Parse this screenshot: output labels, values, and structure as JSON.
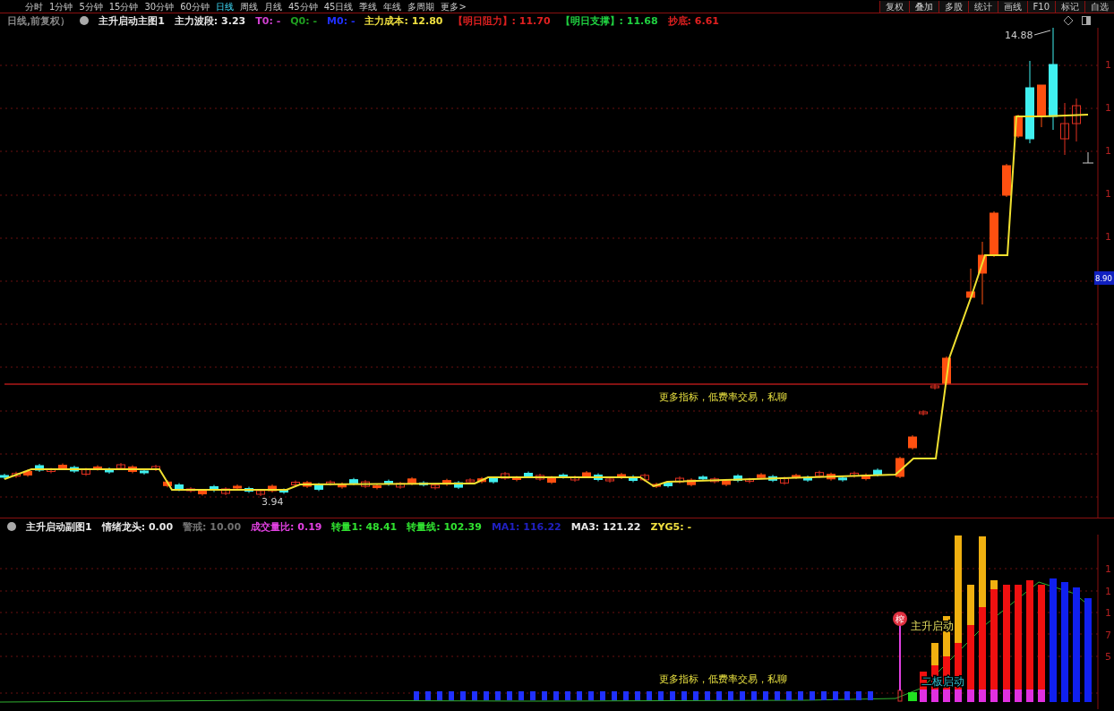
{
  "toolbar": {
    "periods": [
      {
        "label": "分时",
        "selected": false
      },
      {
        "label": "1分钟",
        "selected": false
      },
      {
        "label": "5分钟",
        "selected": false
      },
      {
        "label": "15分钟",
        "selected": false
      },
      {
        "label": "30分钟",
        "selected": false
      },
      {
        "label": "60分钟",
        "selected": false
      },
      {
        "label": "日线",
        "selected": true
      },
      {
        "label": "周线",
        "selected": false
      },
      {
        "label": "月线",
        "selected": false
      },
      {
        "label": "45分钟",
        "selected": false
      },
      {
        "label": "45日线",
        "selected": false
      },
      {
        "label": "季线",
        "selected": false
      },
      {
        "label": "年线",
        "selected": false
      },
      {
        "label": "多周期",
        "selected": false
      },
      {
        "label": "更多>",
        "selected": false
      }
    ],
    "buttons": [
      "复权",
      "叠加",
      "多股",
      "统计",
      "画线",
      "F10",
      "标记",
      "自选"
    ]
  },
  "main_header": {
    "period": "日线,前复权）",
    "indicator": "主升启动主图1",
    "items": [
      {
        "label": "主力波段:",
        "value": "3.23",
        "color": "#e8e8e8"
      },
      {
        "label": "T0:",
        "value": "-",
        "color": "#d040d0"
      },
      {
        "label": "Q0:",
        "value": "-",
        "color": "#20a020"
      },
      {
        "label": "M0:",
        "value": "-",
        "color": "#2030ff"
      },
      {
        "label": "主力成本:",
        "value": "12.80",
        "color": "#f0e040"
      },
      {
        "label": "【明日阻力】:",
        "value": "11.70",
        "color": "#e02020"
      },
      {
        "label": "【明日支撑】:",
        "value": "11.68",
        "color": "#20d040"
      },
      {
        "label": "抄底:",
        "value": "6.61",
        "color": "#e02020"
      }
    ]
  },
  "main_chart": {
    "high_label": "14.88",
    "low_label": "3.94",
    "note": "更多指标，低费率交易，私聊",
    "price_tag": "8.90",
    "axis_labels": [
      "1",
      "1",
      "1",
      "1",
      "1"
    ]
  },
  "sub_header": {
    "indicator": "主升启动副图1",
    "items": [
      {
        "label": "情绪龙头:",
        "value": "0.00",
        "color": "#e8e8e8"
      },
      {
        "label": "警戒:",
        "value": "10.00",
        "color": "#707070"
      },
      {
        "label": "成交量比:",
        "value": "0.19",
        "color": "#e040e0"
      },
      {
        "label": "转量1:",
        "value": "48.41",
        "color": "#30e030"
      },
      {
        "label": "转量线:",
        "value": "102.39",
        "color": "#30e030"
      },
      {
        "label": "MA1:",
        "value": "116.22",
        "color": "#2020c0"
      },
      {
        "label": "MA3:",
        "value": "121.22",
        "color": "#e8e8e8"
      },
      {
        "label": "ZYG5:",
        "value": "-",
        "color": "#f0e040"
      }
    ]
  },
  "sub_chart": {
    "badge": "榨",
    "signals": [
      "主升启动",
      "二板启动"
    ],
    "note": "更多指标，低费率交易，私聊",
    "axis_labels": [
      "1",
      "1",
      "1",
      "7",
      "5"
    ]
  }
}
